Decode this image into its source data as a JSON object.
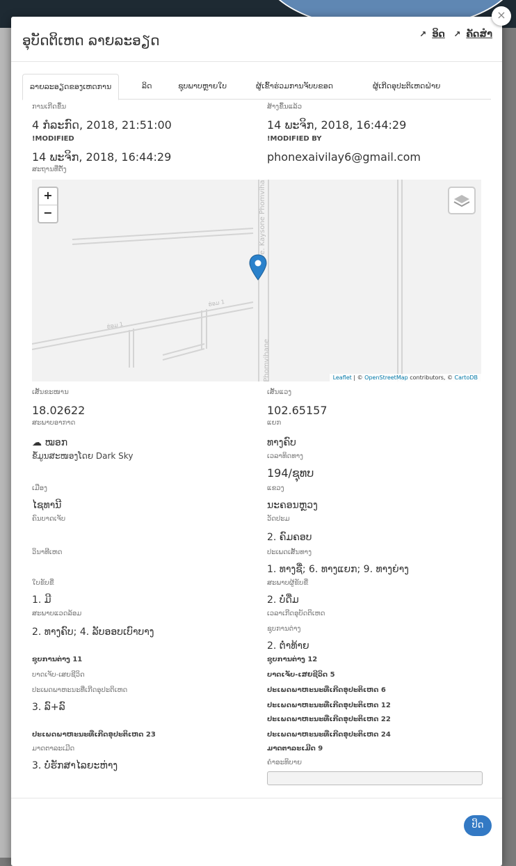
{
  "modal": {
    "title": "ອຸບັດຕິເຫດ ລາຍລະອຽດ",
    "link_edit": "ອິດ",
    "link_print": "ຄັດສຳ",
    "close_symbol": "×"
  },
  "tabs": [
    "ລາຍລະອຽດຂອງເຫດການ",
    "ລິດ",
    "ຊຸບພາບຫຼາຍໃບ",
    "ຜູ້ເຂົ້າຮ່ວມການຈັບບຂອດ",
    "ຜູ້ເກີດອຸປະຕິເຫດຝ່າຍ"
  ],
  "details": {
    "created_label": "ການເກີດຂຶ້ນ",
    "created_value": "4 ກໍລະກົດ, 2018, 21:51:00",
    "created_by_label": "ສ້າງຂຶ້ນແລ້ວ",
    "created_by_value": "14 ພະຈິກ, 2018, 16:44:29",
    "modified_label": "!MODIFIED",
    "modified_value": "14 ພະຈິກ, 2018, 16:44:29",
    "modified_by_label": "!MODIFIED BY",
    "modified_by_value": "phonexaivilay6@gmail.com",
    "location_label": "ສະຖານທີ່ຕັ້ງ"
  },
  "map": {
    "zoom_in": "+",
    "zoom_out": "−",
    "road_name_1": "Ave. Kaysone Phomvihane",
    "road_name_2": "e Phomvihane",
    "road_tag_1": "ຮ່ອມ 1",
    "road_tag_2": "ຮ່ອມ 1",
    "attribution_leaflet": "Leaflet",
    "attribution_osm_pre": " | © ",
    "attribution_osm": "OpenStreetMap",
    "attribution_mid": " contributors, © ",
    "attribution_carto": "CartoDB",
    "marker_color": "#2a81cb"
  },
  "fields": {
    "lat_label": "ເສັ້ນຂະໜານ",
    "lat_value": "18.02622",
    "lng_label": "ເສັ້ນແວງ",
    "lng_value": "102.65157",
    "weather_label": "ສະພາບອາກາດ",
    "weather_icon": "☁",
    "weather_value": "ໝອກ",
    "weather_source": "ຂໍ້ມູນສະໜອງໂດຍ Dark Sky",
    "road_label": "ແຍກ",
    "road_value": "ທາງຄົບ",
    "direction_label": "ເວລາທິດທາງ",
    "direction_value": "194/ຊຸທບ",
    "city_label": "ເມືອງ",
    "city_value": "ໄຊທານີ",
    "province_label": "ແຂວງ",
    "province_value": "ນະຄອນຫຼວງ",
    "place_label": "ຄົນບາດເຈັບ",
    "place_value": "",
    "severity_label": "ວັດປະມ",
    "severity_value": "2. ຄົມຄອບ",
    "cause_label": "ວິນາທີເຫດ",
    "cause_value": "",
    "road_type_label": "ປະເພດເສັ້ນທາງ",
    "road_type_value": "1. ທາງຊື່; 6. ທາງແຍກ; 9. ທາງຍ່າງ",
    "license_label": "ໃບຂັບຂີ່",
    "license_value": "1. ມີ",
    "driver_status_label": "ສະພາບຜູ້ຂັບຂີ່",
    "driver_status_value": "2. ບໍ່ດື່ມ",
    "road_cond_label": "ສະພາບແວດລ້ອມ",
    "road_cond_value": "2. ທາງຄົບ; 4. ລັບອອບເບົາບາງ",
    "accident_time_label": "ເວລາເກີດອຸບັດຕິເຫດ",
    "accident_time_value": "",
    "damage_label": "ຊຸບການຕ່າງ",
    "damage_value": "2. ຕ່ຳທ້າຍ",
    "extra_11_label": "ຊຸບການຕ່າງ 11",
    "extra_12_label": "ຊຸບການຕ່າງ 12",
    "injury_label": "ບາດເຈັບ-ເສຍຊີວິດ",
    "injury_5_label": "ບາດເຈັບ-ເສຍຊີວິດ 5",
    "vehicle_label": "ປະເພດພາຫະນະທີ່ເກີດອຸປະຕິເຫດ",
    "vehicle_value": "3. ລົ+ລົ",
    "vehicle_6_label": "ປະເພດພາຫະນະທີ່ເກີດອຸປະຕິເຫດ 6",
    "vehicle_12_label": "ປະເພດພາຫະນະທີ່ເກີດອຸປະຕິເຫດ 12",
    "vehicle_22_label": "ປະເພດພາຫະນະທີ່ເກີດອຸປະຕິເຫດ 22",
    "vehicle_23_label": "ປະເພດພາຫະນະທີ່ເກີດອຸປະຕິເຫດ 23",
    "vehicle_24_label": "ປະເພດພາຫະນະທີ່ເກີດອຸປະຕິເຫດ 24",
    "measure_label": "ມາດຕາລະເມີດ",
    "measure_value": "3. ບໍ່ຮັກສາໄລຍະຫ່າງ",
    "measure_9_label": "ມາດຕາລະເມີດ 9",
    "note_label": "ຄຳອະທິບາຍ",
    "note_value": ""
  },
  "footer": {
    "close_label": "ປິດ"
  }
}
